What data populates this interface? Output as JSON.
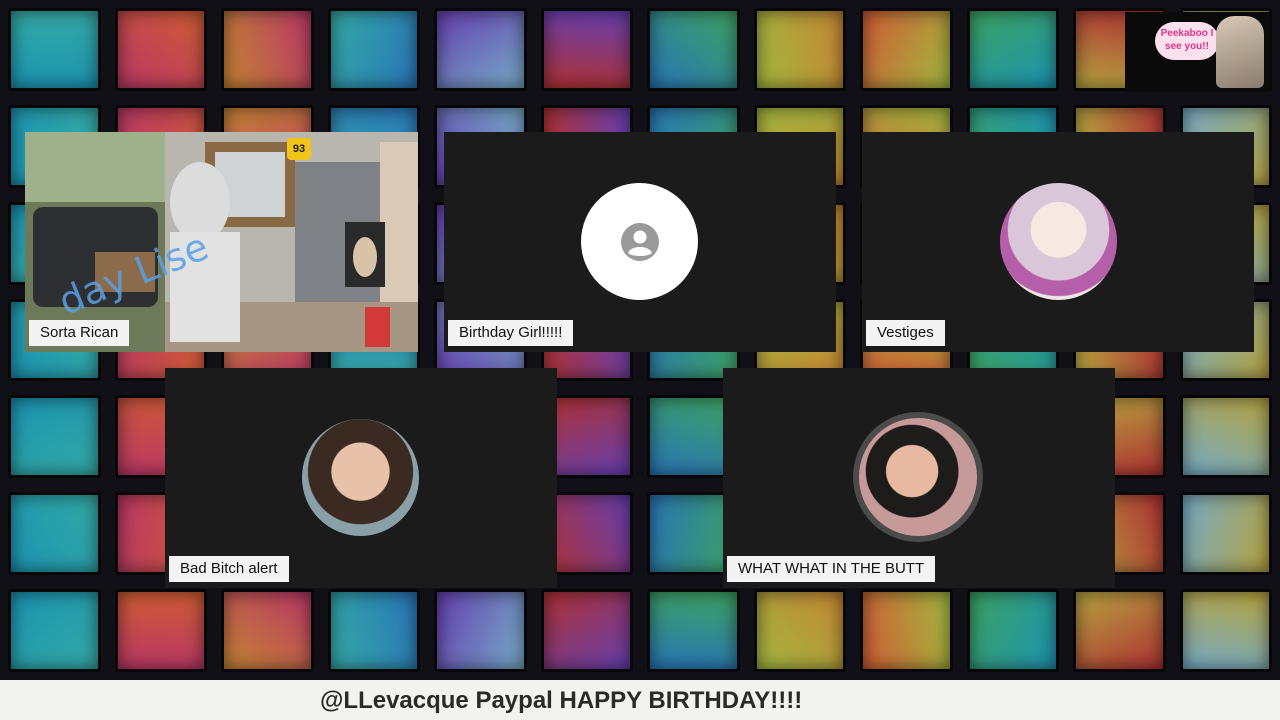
{
  "participants": [
    {
      "name": "Sorta Rican",
      "video_on": true
    },
    {
      "name": "Birthday Girl!!!!!",
      "video_on": false
    },
    {
      "name": "Vestiges",
      "video_on": false
    },
    {
      "name": "Bad Bitch alert",
      "video_on": false
    },
    {
      "name": "WHAT WHAT IN THE BUTT",
      "video_on": false
    }
  ],
  "camera_overlay_text": "day Lise",
  "station_badge": "93",
  "logo_text": "Peekaboo I see you!!",
  "ticker": "@LLevacque Paypal HAPPY BIRTHDAY!!!!",
  "colors": {
    "tile_bg": "#1b1b1b",
    "name_bg": "#f3f3f3",
    "bar_bg": "#f2f2ee"
  }
}
